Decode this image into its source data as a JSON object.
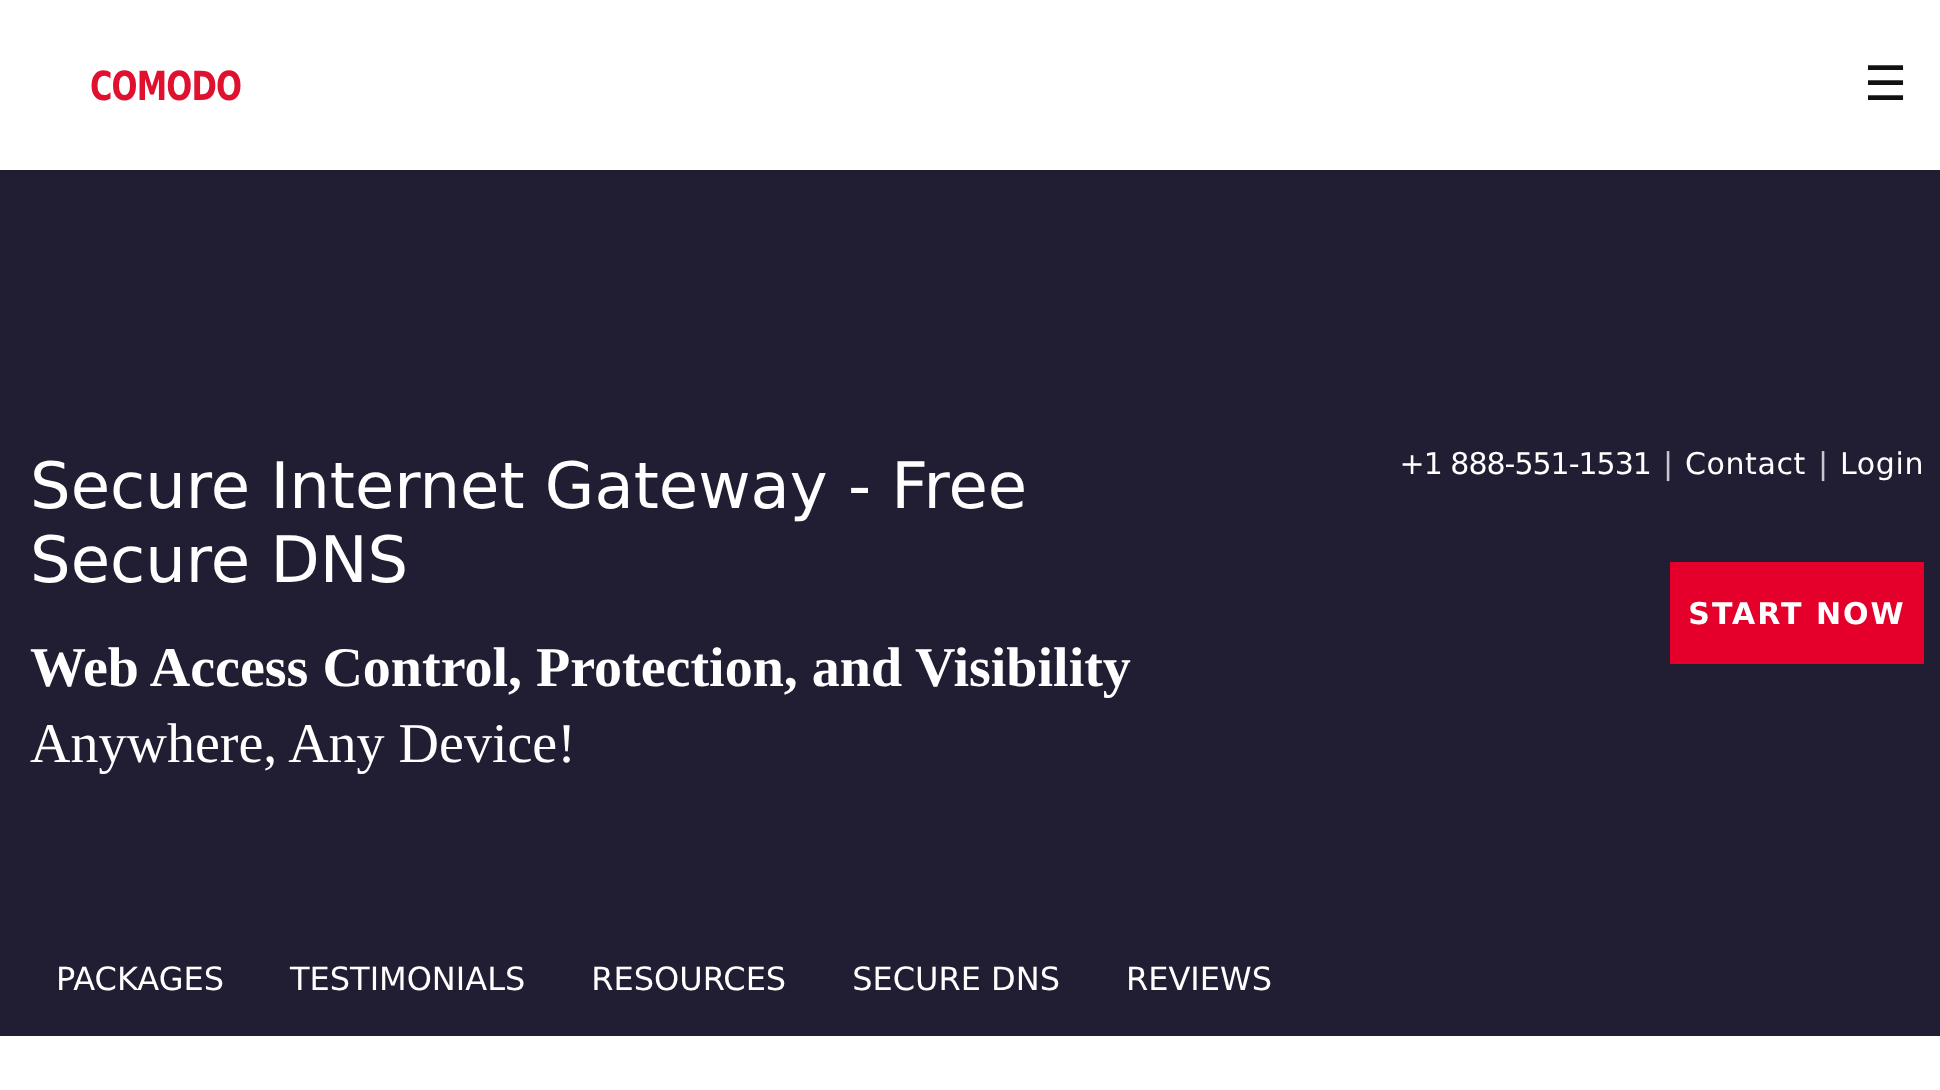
{
  "header": {
    "logo": "COMODO",
    "menu_button": "☰"
  },
  "hero": {
    "title": "Secure Internet Gateway - Free Secure DNS",
    "subtitle": "Web Access Control, Protection, and Visibility",
    "tagline": "Anywhere, Any Device!",
    "contact_bar": [
      {
        "kind": "phone",
        "text": "+1 888-551-1531"
      },
      {
        "kind": "separator",
        "text": "|"
      },
      {
        "kind": "link",
        "text": "Contact"
      },
      {
        "kind": "separator",
        "text": "|"
      },
      {
        "kind": "link",
        "text": "Login"
      }
    ],
    "cta_button": "START NOW"
  },
  "nav": [
    {
      "label": "PACKAGES"
    },
    {
      "label": "TESTIMONIALS"
    },
    {
      "label": "RESOURCES"
    },
    {
      "label": "SECURE DNS"
    },
    {
      "label": "REVIEWS"
    }
  ]
}
